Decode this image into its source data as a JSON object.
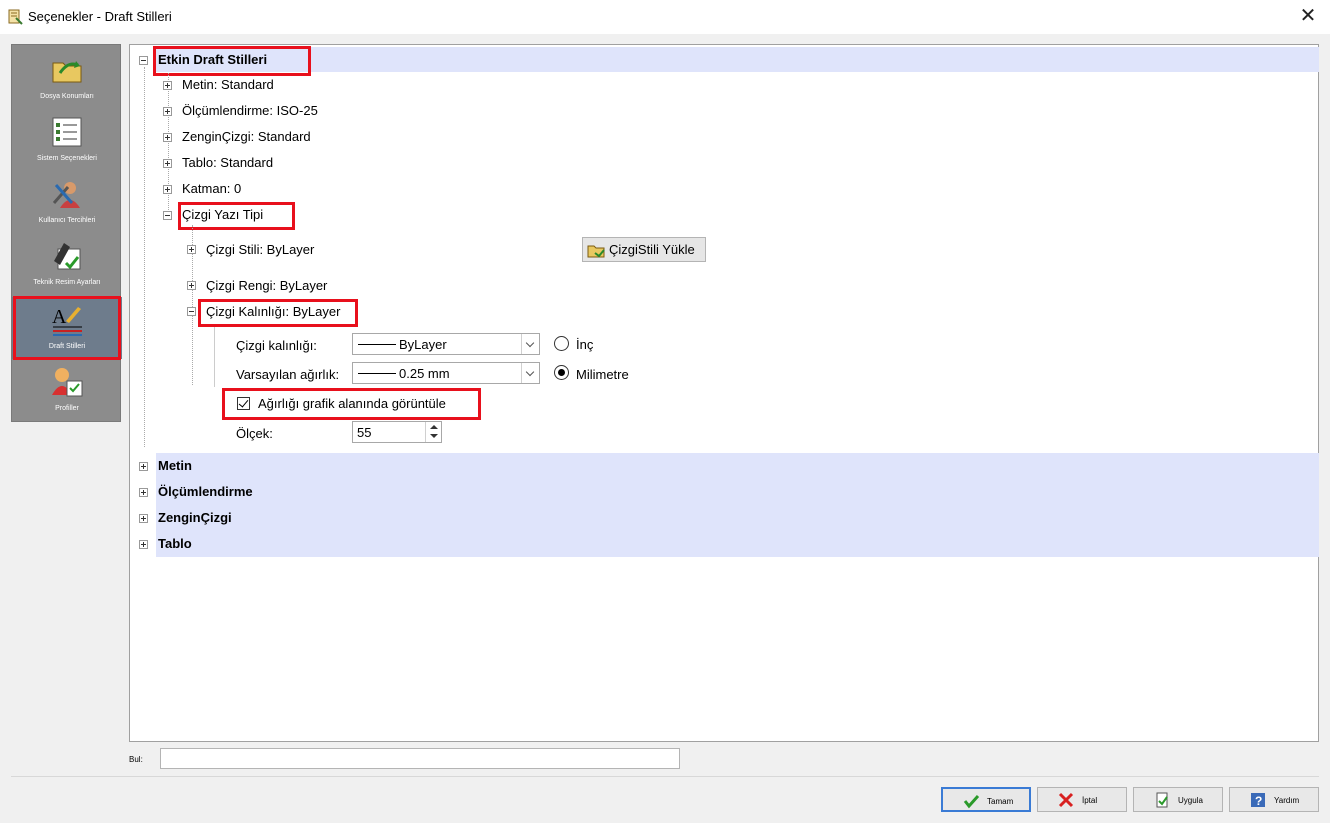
{
  "window": {
    "title": "Seçenekler - Draft Stilleri",
    "close_label": "✕"
  },
  "sidebar": {
    "items": [
      {
        "label": "Dosya Konumları",
        "icon": "folder-arrow-icon"
      },
      {
        "label": "Sistem Seçenekleri",
        "icon": "checklist-icon"
      },
      {
        "label": "Kullanıcı Tercihleri",
        "icon": "user-tools-icon"
      },
      {
        "label": "Teknik Resim Ayarları",
        "icon": "drafting-tools-icon"
      },
      {
        "label": "Draft Stilleri",
        "icon": "text-style-icon",
        "active": true
      },
      {
        "label": "Profiller",
        "icon": "profile-user-icon"
      }
    ]
  },
  "tree": {
    "root": "Etkin Draft Stilleri",
    "children": [
      "Metin: Standard",
      "Ölçümlendirme: ISO-25",
      "ZenginÇizgi: Standard",
      "Tablo: Standard",
      "Katman: 0",
      "Çizgi Yazı Tipi"
    ],
    "line_children": [
      "Çizgi Stili: ByLayer",
      "Çizgi Rengi: ByLayer",
      "Çizgi Kalınlığı: ByLayer"
    ],
    "load_button": "ÇizgiStili Yükle",
    "other_groups": [
      "Metin",
      "Ölçümlendirme",
      "ZenginÇizgi",
      "Tablo"
    ]
  },
  "lineweight": {
    "thickness_label": "Çizgi kalınlığı:",
    "thickness_value": "ByLayer",
    "default_weight_label": "Varsayılan ağırlık:",
    "default_weight_value": "0.25 mm",
    "unit_inch": "İnç",
    "unit_mm": "Milimetre",
    "selected_unit": "Milimetre",
    "display_checkbox": "Ağırlığı grafik alanında görüntüle",
    "display_checked": true,
    "scale_label": "Ölçek:",
    "scale_value": "55"
  },
  "search": {
    "label": "Bul:",
    "value": ""
  },
  "buttons": {
    "ok": "Tamam",
    "cancel": "İptal",
    "apply": "Uygula",
    "help": "Yardım"
  },
  "colors": {
    "highlight_box": "#e8101c",
    "group_band": "#dfe4fb",
    "sidebar": "#8c8c8c"
  }
}
